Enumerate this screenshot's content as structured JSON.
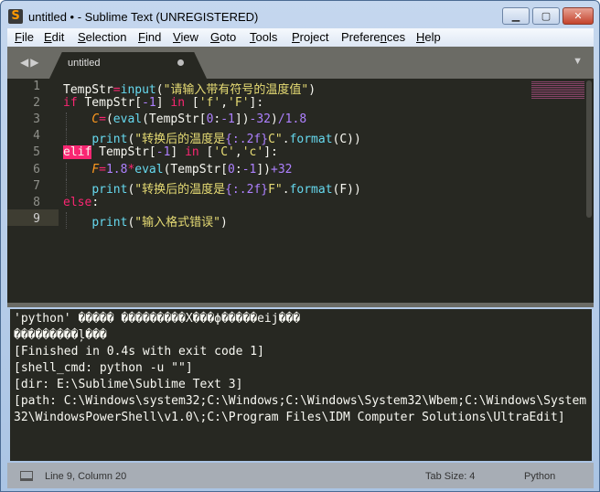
{
  "window": {
    "title": "untitled • - Sublime Text (UNREGISTERED)",
    "icon": "S",
    "minimize": "▁",
    "maximize": "▢",
    "close": "✕"
  },
  "menu": [
    [
      "F",
      "ile"
    ],
    [
      "E",
      "dit"
    ],
    [
      "S",
      "election"
    ],
    [
      "F",
      "ind"
    ],
    [
      "V",
      "iew"
    ],
    [
      "G",
      "oto"
    ],
    [
      "T",
      "ools"
    ],
    [
      "P",
      "roject"
    ],
    [
      "Prefere",
      "n",
      "ces"
    ],
    [
      "H",
      "elp"
    ]
  ],
  "tabbar": {
    "nav": "◀▶",
    "tab_label": "untitled",
    "menu_icon": "▼"
  },
  "editor": {
    "line_numbers": [
      "1",
      "2",
      "3",
      "4",
      "5",
      "6",
      "7",
      "8",
      "9"
    ],
    "lines": [
      [
        [
          "TempStr",
          ""
        ],
        [
          "=",
          "k"
        ],
        [
          "input",
          "f"
        ],
        [
          "(",
          ""
        ],
        [
          "\"请输入带有符号的温度值\"",
          "s"
        ],
        [
          ")",
          ""
        ]
      ],
      [
        [
          "if",
          "k"
        ],
        [
          " TempStr[",
          ""
        ],
        [
          "-1",
          "n"
        ],
        [
          "] ",
          ""
        ],
        [
          "in",
          "k"
        ],
        [
          " [",
          ""
        ],
        [
          "'f'",
          "s"
        ],
        [
          ",",
          ""
        ],
        [
          "'F'",
          "s"
        ],
        [
          "]:",
          ""
        ]
      ],
      [
        [
          "    ",
          ""
        ],
        [
          "C",
          "v"
        ],
        [
          "=",
          "k"
        ],
        [
          "(",
          ""
        ],
        [
          "eval",
          "f"
        ],
        [
          "(TempStr[",
          ""
        ],
        [
          "0",
          "n"
        ],
        [
          ":",
          ""
        ],
        [
          "-1",
          "n"
        ],
        [
          "])",
          ""
        ],
        [
          "-32",
          "n"
        ],
        [
          ")",
          ""
        ],
        [
          "/1.8",
          "n"
        ]
      ],
      [
        [
          "    ",
          ""
        ],
        [
          "print",
          "f"
        ],
        [
          "(",
          ""
        ],
        [
          "\"转换后的温度是",
          "s"
        ],
        [
          "{:.2f}",
          "n"
        ],
        [
          "C\"",
          "s"
        ],
        [
          ".",
          ""
        ],
        [
          "format",
          "f"
        ],
        [
          "(C))",
          ""
        ]
      ],
      [
        [
          "elif",
          "hl"
        ],
        [
          " TempStr[",
          ""
        ],
        [
          "-1",
          "n"
        ],
        [
          "] ",
          ""
        ],
        [
          "in",
          "k"
        ],
        [
          " [",
          ""
        ],
        [
          "'C'",
          "s"
        ],
        [
          ",",
          ""
        ],
        [
          "'c'",
          "s"
        ],
        [
          "]:",
          ""
        ]
      ],
      [
        [
          "    ",
          ""
        ],
        [
          "F",
          "v"
        ],
        [
          "=",
          "k"
        ],
        [
          "1.8",
          "n"
        ],
        [
          "*",
          "k"
        ],
        [
          "eval",
          "f"
        ],
        [
          "(TempStr[",
          ""
        ],
        [
          "0",
          "n"
        ],
        [
          ":",
          ""
        ],
        [
          "-1",
          "n"
        ],
        [
          "])",
          ""
        ],
        [
          "+32",
          "n"
        ]
      ],
      [
        [
          "    ",
          ""
        ],
        [
          "print",
          "f"
        ],
        [
          "(",
          ""
        ],
        [
          "\"转换后的温度是",
          "s"
        ],
        [
          "{:.2f}",
          "n"
        ],
        [
          "F\"",
          "s"
        ],
        [
          ".",
          ""
        ],
        [
          "format",
          "f"
        ],
        [
          "(F))",
          ""
        ]
      ],
      [
        [
          "else",
          "k"
        ],
        [
          ":",
          ""
        ]
      ],
      [
        [
          "    ",
          ""
        ],
        [
          "print",
          "f"
        ],
        [
          "(",
          ""
        ],
        [
          "\"输入格式错误\"",
          "s"
        ],
        [
          ")",
          ""
        ]
      ]
    ]
  },
  "output": {
    "lines": [
      "'python' ����� ���������X���ϕ�����eij���",
      "���������ļ���",
      "[Finished in 0.4s with exit code 1]",
      "[shell_cmd: python -u \"\"]",
      "[dir: E:\\Sublime\\Sublime Text 3]",
      "[path: C:\\Windows\\system32;C:\\Windows;C:\\Windows\\System32\\Wbem;C:\\Windows\\System32\\WindowsPowerShell\\v1.0\\;C:\\Program Files\\IDM Computer Solutions\\UltraEdit]"
    ]
  },
  "status": {
    "position": "Line 9, Column 20",
    "tab_size": "Tab Size: 4",
    "syntax": "Python"
  }
}
